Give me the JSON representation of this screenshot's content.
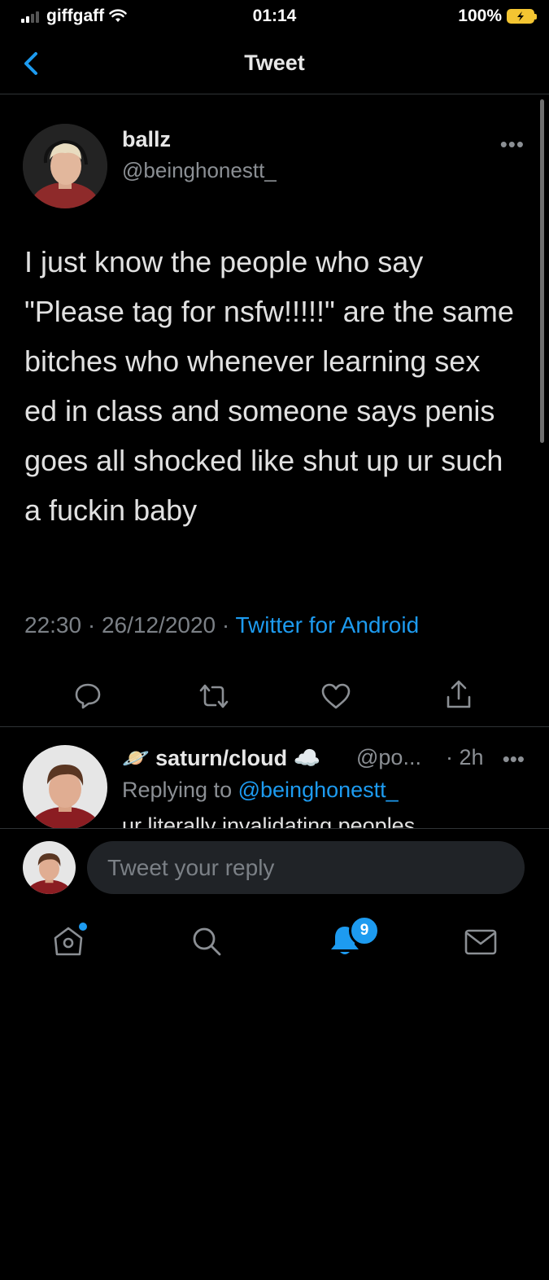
{
  "status_bar": {
    "carrier": "giffgaff",
    "time": "01:14",
    "battery": "100%"
  },
  "header": {
    "title": "Tweet"
  },
  "tweet": {
    "author_name": "ballz",
    "author_handle": "@beinghonestt_",
    "text": "I just know the people who say \"Please tag for nsfw!!!!!\" are the same bitches who whenever learning sex ed in class and someone says penis goes all shocked like shut up ur such a fuckin baby",
    "time": "22:30",
    "date": "26/12/2020",
    "source": "Twitter for Android"
  },
  "reply": {
    "name": "saturn/cloud",
    "handle": "@po...",
    "time": "2h",
    "replying_prefix": "Replying to",
    "replying_to": "@beinghonestt_",
    "text": "ur literally invalidating peoples"
  },
  "compose": {
    "placeholder": "Tweet your reply"
  },
  "tab_bar": {
    "notifications_badge": "9"
  },
  "colors": {
    "accent": "#1d9bf0",
    "background": "#000000",
    "battery": "#f4c532"
  }
}
